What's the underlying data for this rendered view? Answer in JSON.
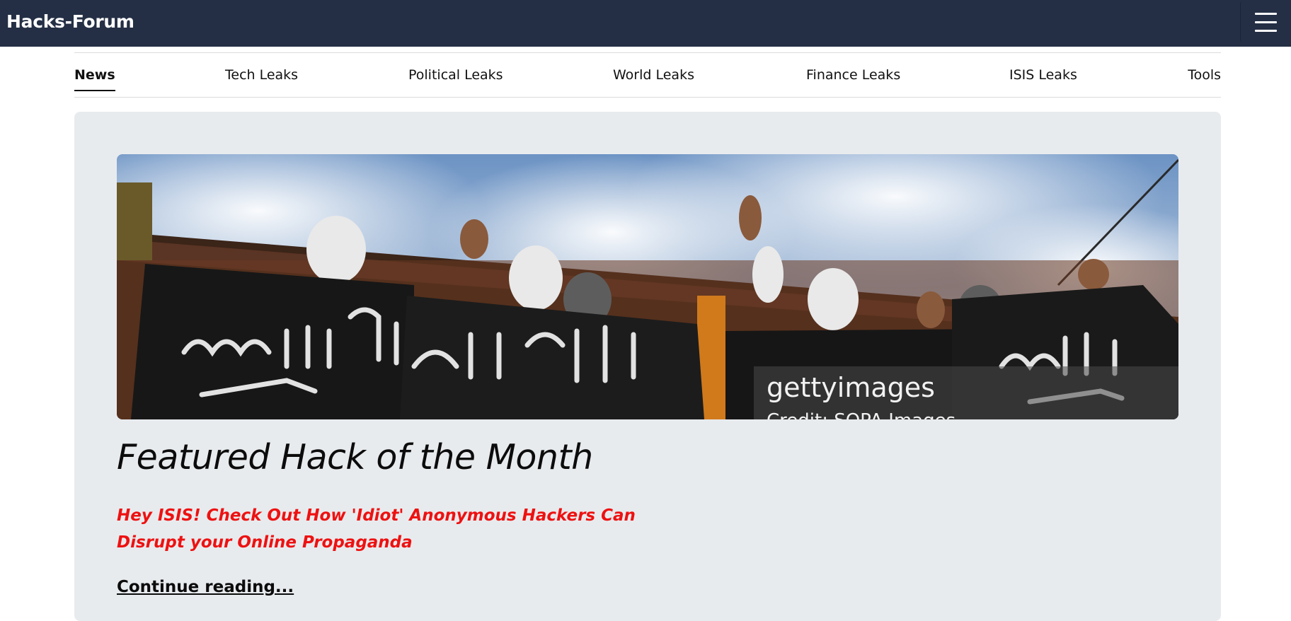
{
  "header": {
    "brand": "Hacks-Forum",
    "menu_icon": "hamburger-menu-icon",
    "background_color": "#242f45"
  },
  "nav": {
    "items": [
      {
        "label": "News",
        "active": true
      },
      {
        "label": "Tech Leaks",
        "active": false
      },
      {
        "label": "Political Leaks",
        "active": false
      },
      {
        "label": "World Leaks",
        "active": false
      },
      {
        "label": "Finance Leaks",
        "active": false
      },
      {
        "label": "ISIS Leaks",
        "active": false
      },
      {
        "label": "Tools",
        "active": false
      }
    ]
  },
  "featured": {
    "image": {
      "watermark_brand": "gettyimages",
      "watermark_credit": "Credit: SOPA Images"
    },
    "title": "Featured Hack of the Month",
    "headline": "Hey ISIS! Check Out How 'Idiot' Anonymous Hackers Can Disrupt your Online Propaganda",
    "headline_color": "#ee1111",
    "link_label": "Continue reading..."
  }
}
